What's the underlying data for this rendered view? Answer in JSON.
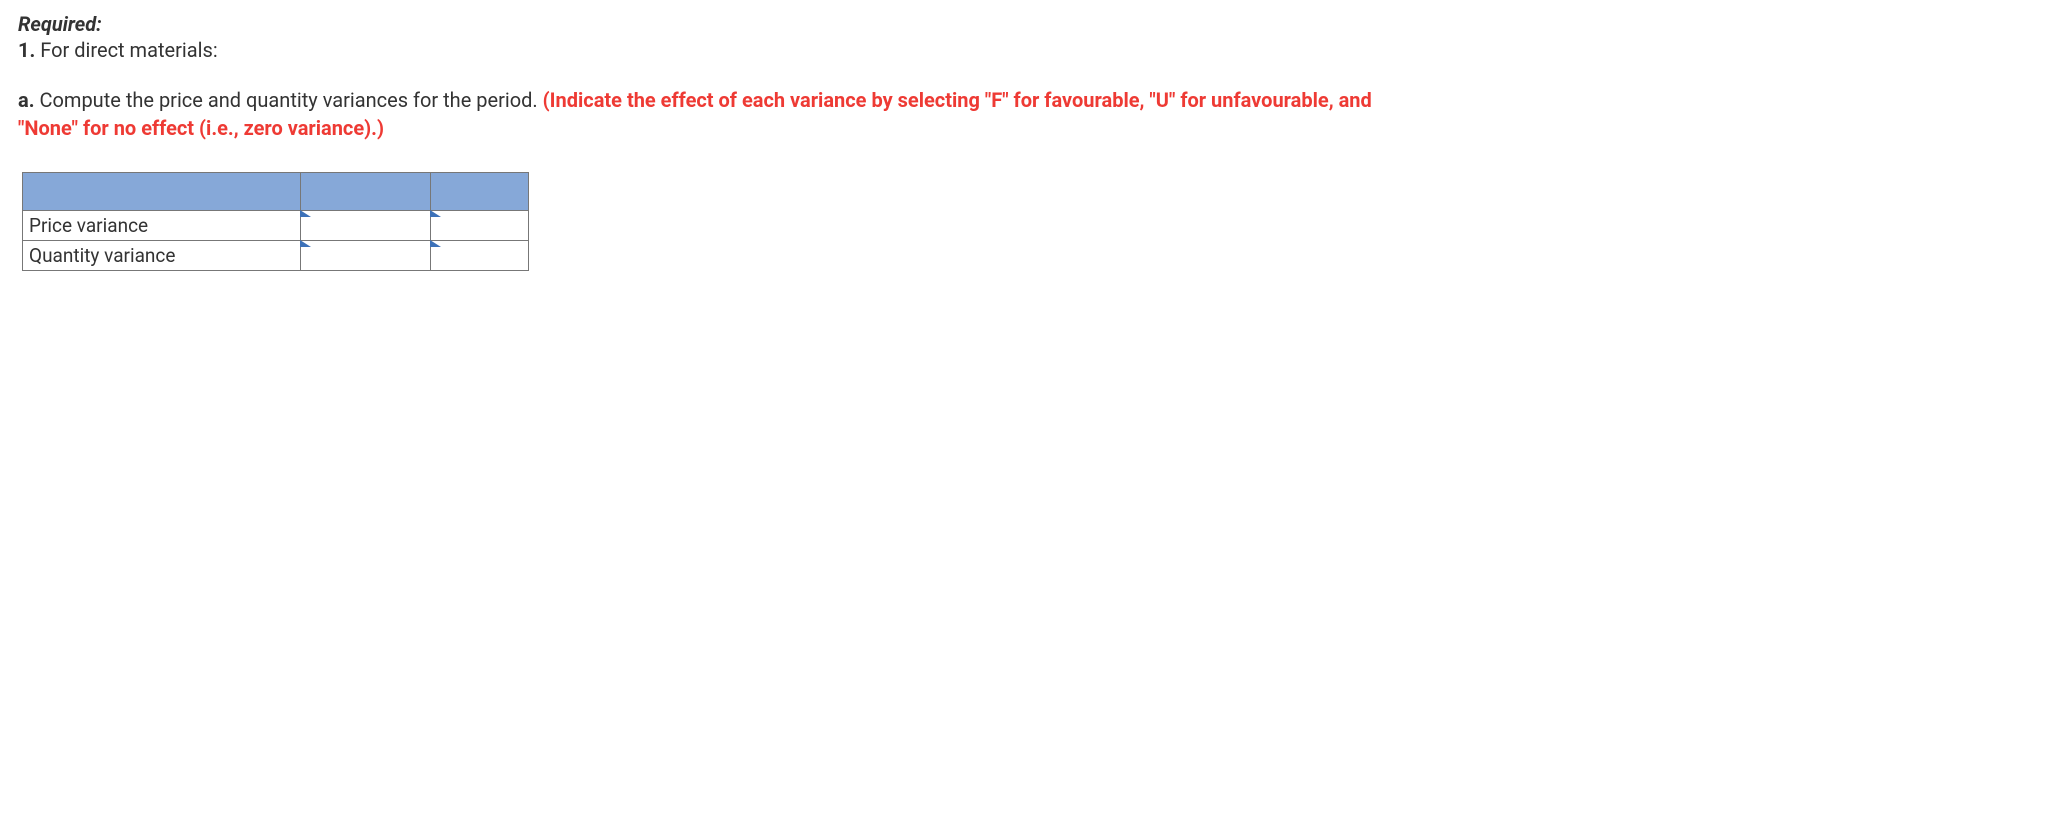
{
  "heading": "Required:",
  "item": {
    "number": "1.",
    "text": "For direct materials:"
  },
  "subitem": {
    "letter": "a.",
    "plain": "Compute the price and quantity variances for the period. ",
    "emph": "(Indicate the effect of each variance by selecting \"F\" for favourable, \"U\" for unfavourable, and \"None\" for no effect (i.e., zero variance).)"
  },
  "table": {
    "rows": [
      {
        "label": "Price variance",
        "amount": "",
        "effect": ""
      },
      {
        "label": "Quantity variance",
        "amount": "",
        "effect": ""
      }
    ]
  }
}
